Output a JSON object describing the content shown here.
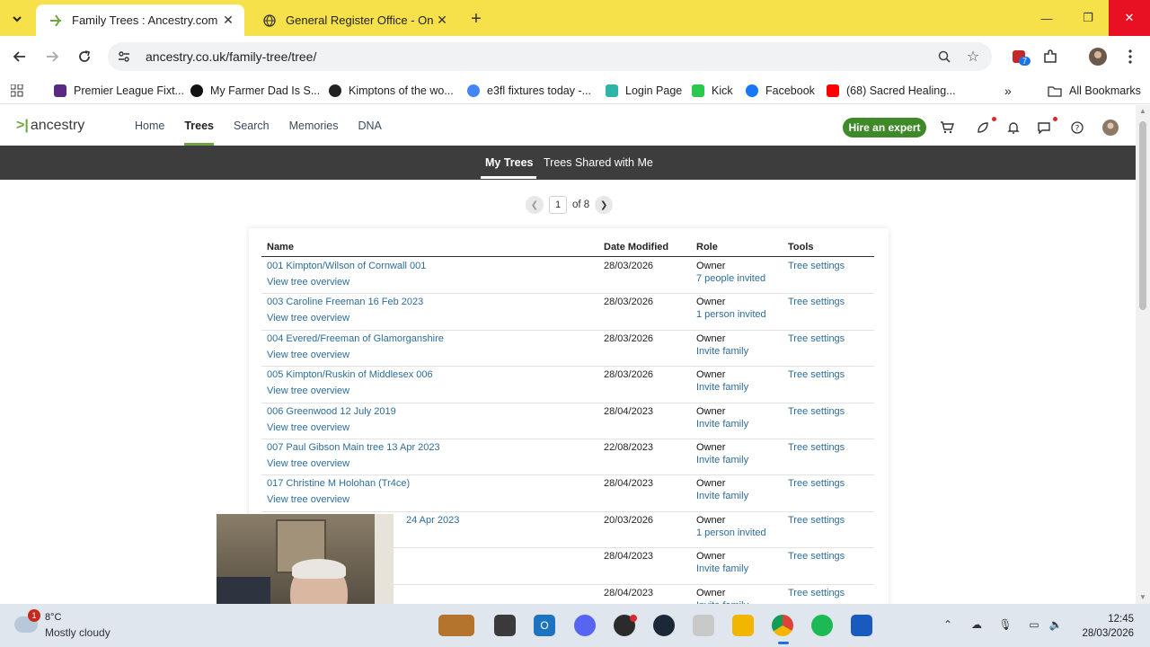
{
  "browser": {
    "tabs": [
      {
        "title": "Family Trees : Ancestry.com",
        "active": true
      },
      {
        "title": "General Register Office - Online",
        "active": false
      }
    ],
    "url": "ancestry.co.uk/family-tree/tree/",
    "extension_badge": "7",
    "bookmarks": [
      {
        "label": "Premier League Fixt...",
        "color": "#5a2a82"
      },
      {
        "label": "My Farmer Dad Is S...",
        "color": "#111111"
      },
      {
        "label": "Kimptons of the wo...",
        "color": "#222222"
      },
      {
        "label": "e3fl fixtures today -...",
        "color": "#4285f4"
      },
      {
        "label": "Login Page",
        "color": "#2fb5a8"
      },
      {
        "label": "Kick",
        "color": "#2cc84d"
      },
      {
        "label": "Facebook",
        "color": "#1877f2"
      },
      {
        "label": "(68) Sacred Healing...",
        "color": "#ff0000"
      }
    ],
    "all_bookmarks": "All Bookmarks"
  },
  "ancestry": {
    "logo": "ancestry",
    "nav": [
      "Home",
      "Trees",
      "Search",
      "Memories",
      "DNA"
    ],
    "active_nav": "Trees",
    "hire_expert": "Hire an expert",
    "subnav": [
      "My Trees",
      "Trees Shared with Me"
    ],
    "pager": {
      "current": "1",
      "of_text": "of 8"
    },
    "table": {
      "headers": {
        "name": "Name",
        "date": "Date Modified",
        "role": "Role",
        "tools": "Tools"
      },
      "rows": [
        {
          "name": "001 Kimpton/Wilson of Cornwall 001",
          "view": "View tree overview",
          "date": "28/03/2026",
          "role": "Owner",
          "invite": "7 people invited",
          "tools": "Tree settings"
        },
        {
          "name": "003 Caroline Freeman 16 Feb 2023",
          "view": "View tree overview",
          "date": "28/03/2026",
          "role": "Owner",
          "invite": "1 person invited",
          "tools": "Tree settings"
        },
        {
          "name": "004 Evered/Freeman of Glamorganshire",
          "view": "View tree overview",
          "date": "28/03/2026",
          "role": "Owner",
          "invite": "Invite family",
          "tools": "Tree settings"
        },
        {
          "name": "005 Kimpton/Ruskin of Middlesex 006",
          "view": "View tree overview",
          "date": "28/03/2026",
          "role": "Owner",
          "invite": "Invite family",
          "tools": "Tree settings"
        },
        {
          "name": "006 Greenwood 12 July 2019",
          "view": "View tree overview",
          "date": "28/04/2023",
          "role": "Owner",
          "invite": "Invite family",
          "tools": "Tree settings"
        },
        {
          "name": "007 Paul Gibson Main tree 13 Apr 2023",
          "view": "View tree overview",
          "date": "22/08/2023",
          "role": "Owner",
          "invite": "Invite family",
          "tools": "Tree settings"
        },
        {
          "name": "017 Christine M Holohan (Tr4ce)",
          "view": "View tree overview",
          "date": "28/04/2023",
          "role": "Owner",
          "invite": "Invite family",
          "tools": "Tree settings"
        },
        {
          "name": "24 Apr 2023",
          "view": "",
          "date": "20/03/2026",
          "role": "Owner",
          "invite": "1 person invited",
          "tools": "Tree settings"
        },
        {
          "name": "",
          "view": "",
          "date": "28/04/2023",
          "role": "Owner",
          "invite": "Invite family",
          "tools": "Tree settings"
        },
        {
          "name": "",
          "view": "",
          "date": "28/04/2023",
          "role": "Owner",
          "invite": "Invite family",
          "tools": "Tree settings"
        }
      ]
    }
  },
  "taskbar": {
    "weather_badge": "1",
    "temperature": "8°C",
    "condition": "Mostly cloudy",
    "time": "12:45",
    "date": "28/03/2026"
  },
  "colors": {
    "chrome_frame": "#f6e14a",
    "ancestry_green": "#6fa544",
    "link_blue": "#2d6d99",
    "subnav_bg": "#3d3d3d"
  }
}
